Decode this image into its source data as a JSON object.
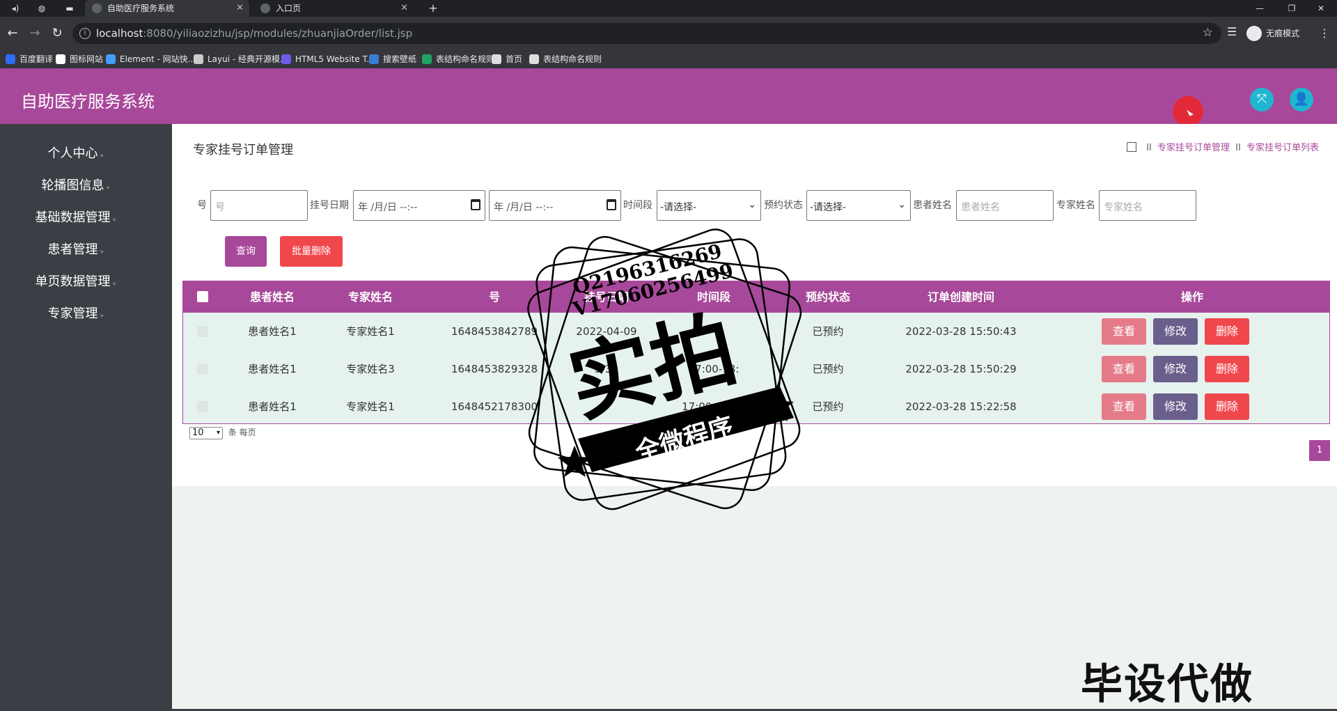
{
  "browser": {
    "tabs": [
      {
        "title": "自助医疗服务系统",
        "active": true
      },
      {
        "title": "入口页",
        "active": false
      }
    ],
    "new_tab": "+",
    "url_host": "localhost",
    "url_rest": ":8080/yiliaozizhu/jsp/modules/zhuanjiaOrder/list.jsp",
    "incognito_label": "无痕模式",
    "bookmarks": [
      {
        "label": "百度翻译",
        "color": "#2e6cf6"
      },
      {
        "label": "图标网站",
        "color": "#ffffff"
      },
      {
        "label": "Element - 网站快...",
        "color": "#409eff"
      },
      {
        "label": "Layui - 经典开源模...",
        "color": "#cccccc"
      },
      {
        "label": "HTML5 Website T...",
        "color": "#6c5ce7"
      },
      {
        "label": "搜索壁纸",
        "color": "#3a7bd5"
      },
      {
        "label": "表结构命名规则",
        "color": "#1fa463"
      },
      {
        "label": "首页",
        "color": "#dddddd"
      },
      {
        "label": "表结构命名规则",
        "color": "#dddddd"
      }
    ]
  },
  "app": {
    "title": "自助医疗服务系统",
    "accent": "#a8489a",
    "sidebar": [
      {
        "label": "个人中心"
      },
      {
        "label": "轮播图信息"
      },
      {
        "label": "基础数据管理"
      },
      {
        "label": "患者管理"
      },
      {
        "label": "单页数据管理"
      },
      {
        "label": "专家管理"
      }
    ],
    "page_title": "专家挂号订单管理",
    "breadcrumb": [
      "专家挂号订单管理",
      "专家挂号订单列表"
    ],
    "breadcrumb_sep": "II",
    "filters": {
      "number_label": "号",
      "number_placeholder": "号",
      "date_label": "挂号日期",
      "date_placeholder": "年 /月/日 --:--",
      "time_label": "时间段",
      "time_selected": "-请选择-",
      "status_label": "预约状态",
      "status_selected": "-请选择-",
      "patient_label": "患者姓名",
      "patient_placeholder": "患者姓名",
      "expert_label": "专家姓名",
      "expert_placeholder": "专家姓名"
    },
    "buttons": {
      "query": "查询",
      "batch_delete": "批量删除"
    },
    "table": {
      "headers": [
        "患者姓名",
        "专家姓名",
        "号",
        "挂号日期",
        "时间段",
        "预约状态",
        "订单创建时间",
        "操作"
      ],
      "rows": [
        {
          "patient": "患者姓名1",
          "expert": "专家姓名1",
          "number": "1648453842789",
          "date": "2022-04-09",
          "time": "",
          "status": "已预约",
          "created": "2022-03-28 15:50:43"
        },
        {
          "patient": "患者姓名1",
          "expert": "专家姓名3",
          "number": "1648453829328",
          "date": "3-30",
          "time": "17:00-18:",
          "status": "已预约",
          "created": "2022-03-28 15:50:29"
        },
        {
          "patient": "患者姓名1",
          "expert": "专家姓名1",
          "number": "1648452178300",
          "date": "",
          "time": "17:00-18:00",
          "status": "已预约",
          "created": "2022-03-28 15:22:58"
        }
      ],
      "actions": {
        "view": "查看",
        "edit": "修改",
        "delete": "删除"
      },
      "colors": {
        "view": "#e57b89",
        "edit": "#6a5f8c",
        "delete": "#f0474d"
      }
    },
    "pagination": {
      "page_size": "10",
      "per_page_label": "条 每页",
      "current_page": "1"
    }
  },
  "watermark": {
    "line1": "Q2196316269",
    "line2": "V17060256499",
    "big": "实拍",
    "ribbon": "全微程序",
    "corner": "毕设代做"
  }
}
